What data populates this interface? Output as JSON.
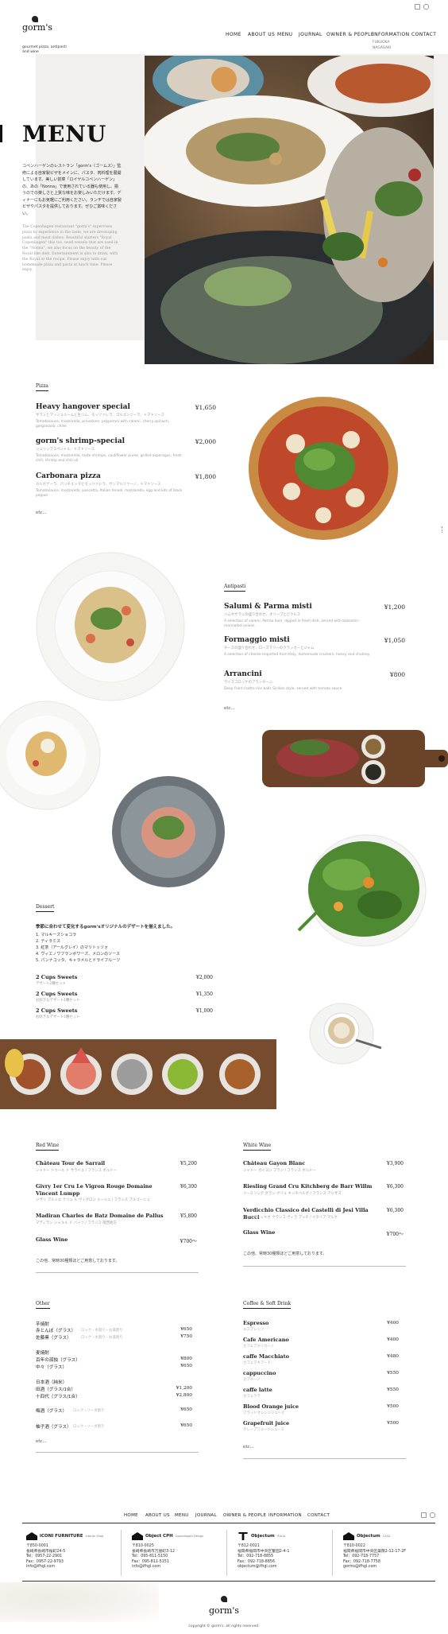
{
  "brand": {
    "logo_text": "gorm's",
    "tagline_line1": "gourmet pizza, antipasti",
    "tagline_line2": "and wine"
  },
  "nav": {
    "items": [
      "HOME",
      "ABOUT US",
      "MENU",
      "JOURNAL",
      "OWNER & PEOPLE",
      "INFORMATION",
      "CONTACT"
    ],
    "sub_items": [
      "FUKUOKA",
      "NAGASAKI"
    ]
  },
  "hero": {
    "title": "MENU",
    "intro_ja": "コペンハーゲンのレストラン「gorm's（ゴームス）」監修による自家製ピザをメインに、パスタ、肉料理を展開しています。美しい前菜「ロイヤルコペンハーゲン」の、あの「Nonna」で使用されている器も使用し、揃うのでの楽しさと上質な味をお楽しみいただけます。ディナーにもお気軽にご利用ください。ランチでは自家製ピザやパスタを提供しております。ぜひご賞味ください。",
    "intro_en": "The Copenhagen restaurant \"gorm's\" supervises pizza by experience in the taste, we are developing pasta and meat dishes. Beautiful starters \"Royal Copenhagen\" this too, used vessels that are used in the \"Nonna\", we also focus on the beauty of the Royal-like dish. Entertainment is also to drink, with the Royal or the recipe. Please enjoy with our homemade pizza and pasta at lunch time. Please enjoy."
  },
  "pizza": {
    "label": "Pizza",
    "items": [
      {
        "name": "Heavy hangover special",
        "price": "¥1,650",
        "ja": "サラミとマッシュルームと生ハム、モッツァレラ、ゴルゴンゾーラ、トマトソース",
        "en": "Tomatosauce, mozzarella, provolone, pepperoni with salami, cherry,spinach, gorgonzola, chilie"
      },
      {
        "name": "gorm's shrimp-special",
        "price": "¥2,000",
        "ja": "シュリンプスペシャル、トマトソース",
        "en": "Tomatosauce, mozzarella, taste shrimps, cauliflower puree, grilled asparagus, fresh chili, shrimp and chili oil"
      },
      {
        "name": "Carbonara pizza",
        "price": "¥1,800",
        "ja": "カルボナーラ、パンチェッタとモッツァレラ、サンマルツァーノ、トマトソース",
        "en": "Tomatosauce, mozzarella, pancetta, Italian fennel, mozzarella, egg and lots of black pepper"
      }
    ],
    "etc": "etc..."
  },
  "antipasti": {
    "label": "Antipasti",
    "items": [
      {
        "name": "Salumi & Parma misti",
        "price": "¥1,200",
        "ja": "ハムやサラミの盛り合わせ、オリーブとピクルス",
        "en": "A selection of salami, Parma ham, dipped in fresh dish, served with balsamic-marinated onions"
      },
      {
        "name": "Formaggio misti",
        "price": "¥1,050",
        "ja": "チーズの盛り合わせ、ローズマリーのクラッカーとジャム",
        "en": "A selection of cheese imported from Italy, homemade crackers, honey and chutney"
      },
      {
        "name": "Arrancini",
        "price": "¥800",
        "ja": "ライスコロッケのアランチーニ",
        "en": "Deep fried risotto rice balls Sicilian style, served with tomato sauce"
      }
    ],
    "etc": "etc..."
  },
  "dessert": {
    "label": "Dessert",
    "note": "季節に合わせて変化するgorm'sオリジナルのデザートを揃えました。",
    "list": [
      "1. マルキーズショコラ",
      "2. ティラミス",
      "3. 紅茶（アールグレイ）のマリトッツォ",
      "4. ヴィエノワフランボワーズ、メロンのソース",
      "5. パンナコッタ、キャラメルとドライフルーツ"
    ],
    "items": [
      {
        "name": "2 Cups Sweets",
        "sub": "デザート2種セット",
        "price": "¥2,000"
      },
      {
        "name": "2 Cups Sweets",
        "sub": "お好きなデザート1種セット",
        "price": "¥1,350"
      },
      {
        "name": "2 Cups Sweets",
        "sub": "お好きなデザート1種セット",
        "price": "¥1,000"
      }
    ]
  },
  "red_wine": {
    "label": "Red Wine",
    "items": [
      {
        "name": "Château Tour de Sarrail",
        "sub": "シャトー トゥール ド サライユ / フランス ボルドー",
        "price": "¥5,200"
      },
      {
        "name": "Givry 1er Cru Le Vigron Rouge Domaine Vincent Lumpp",
        "sub": "ジヴリ プルミエ クリュ ル ヴィグロン ルージュ / フランス ブルゴーニュ",
        "price": "¥6,300"
      },
      {
        "name": "Madiran Charles de Batz Domaine de Pallus",
        "sub": "マディラン シャルル ド バッツ / フランス 南西地方",
        "price": "¥5,800"
      },
      {
        "name": "Glass Wine",
        "sub": "",
        "price": "¥700〜"
      }
    ],
    "note": "この他、常時30種類ほどご用意しております。"
  },
  "white_wine": {
    "label": "White Wine",
    "items": [
      {
        "name": "Château Gayon Blanc",
        "sub": "シャトー ガイヨン ブラン / フランス ボルドー",
        "price": "¥3,900"
      },
      {
        "name": "Riesling Grand Cru Kitchberg de Barr Willm",
        "sub": "リースリング グラン クリュ キッチベルグ / フランス アルザス",
        "price": "¥6,300"
      },
      {
        "name": "Verdicchio Classico dei Castelli di Jesi Villa Bucci",
        "sub": "ヴェルディッキオ クラシコ ヴィラ ブッチ / イタリア マルケ",
        "price": "¥6,300"
      },
      {
        "name": "Glass Wine",
        "sub": "",
        "price": "¥700〜"
      }
    ],
    "note": "この他、常時30種類ほどご用意しております。"
  },
  "other": {
    "label": "Other",
    "groups": [
      {
        "title": "芋焼酎",
        "items": [
          {
            "name": "赤とんぼ（グラス）",
            "sub": "ロック・水割り・お湯割り",
            "price": "¥650"
          },
          {
            "name": "佐藤黒（グラス）",
            "sub": "ロック・水割り・お湯割り",
            "price": "¥750"
          }
        ]
      },
      {
        "title": "麦焼酎",
        "items": [
          {
            "name": "百年の孤独（グラス）",
            "sub": "",
            "price": "¥800"
          },
          {
            "name": "中々（グラス）",
            "sub": "",
            "price": "¥650"
          }
        ]
      },
      {
        "title": "日本酒（純米）",
        "items": [
          {
            "name": "田酒（グラス/1合）",
            "sub": "",
            "price": "¥1,200"
          },
          {
            "name": "十四代（グラス/1合）",
            "sub": "",
            "price": "¥2,800"
          }
        ]
      },
      {
        "title": "",
        "items": [
          {
            "name": "梅酒（グラス）",
            "sub": "ロック・ソーダ割り",
            "price": "¥650"
          }
        ]
      },
      {
        "title": "",
        "items": [
          {
            "name": "柚子酒（グラス）",
            "sub": "ロック・ソーダ割り",
            "price": "¥650"
          }
        ]
      }
    ],
    "etc": "etc..."
  },
  "coffee": {
    "label": "Coffee & Soft Drink",
    "items": [
      {
        "name": "Espresso",
        "sub": "エスプレッソ",
        "price": "¥400"
      },
      {
        "name": "Cafe Americano",
        "sub": "カフェアメリカーノ",
        "price": "¥400"
      },
      {
        "name": "caffe Macchiato",
        "sub": "カフェマキアート",
        "price": "¥480"
      },
      {
        "name": "cappuccino",
        "sub": "カプチーノ",
        "price": "¥550"
      },
      {
        "name": "caffe latte",
        "sub": "カフェラテ",
        "price": "¥550"
      },
      {
        "name": "Blood Orange juice",
        "sub": "ブラッドオレンジジュース",
        "price": "¥500"
      },
      {
        "name": "Grapefruit juice",
        "sub": "グレープフルーツジュース",
        "price": "¥500"
      }
    ],
    "etc": "etc..."
  },
  "footer": {
    "nav": [
      "HOME",
      "ABOUT US",
      "MENU",
      "JOURNAL",
      "OWNER & PEOPLE",
      "INFORMATION",
      "CONTACT"
    ],
    "shops": [
      {
        "name": "iCONI FURNITURE",
        "sub": "Interior Shop",
        "lines": [
          "〒850-0001",
          "長崎県長崎市桜町24-5",
          "Tel：0957-22-2901",
          "Fax：0957-22-9793",
          "info@ifhgl.com"
        ]
      },
      {
        "name": "Object CPH",
        "sub": "Copenhagen Design",
        "lines": [
          "〒810-0025",
          "長崎県長崎市万屋町3-12",
          "Tel：095-811-5150",
          "Fax：095-811-5151",
          "info@ifhgl.com"
        ]
      },
      {
        "name": "Objectum",
        "sub": "ITALIA",
        "lines": [
          "〒812-0021",
          "福岡県福岡市中央区警固2-4-1",
          "Tel：092-718-8855",
          "Fax：092-718-8856",
          "objectum@ifhgl.com"
        ]
      },
      {
        "name": "Objectum",
        "sub": "CASA",
        "lines": [
          "〒810-0022",
          "福岡県福岡市中央区薬院2-12-17-2F",
          "Tel：092-718-7757",
          "Fax：092-718-7758",
          "gorms@ifhgl.com"
        ]
      }
    ],
    "logo_text": "gorm's",
    "copyright": "copyright © gorm's. all rights reserved."
  },
  "colors": {
    "text": "#222222",
    "muted": "#9a9a9a",
    "hero_bg": "#f1f0ee",
    "wood": "#6b4329"
  }
}
